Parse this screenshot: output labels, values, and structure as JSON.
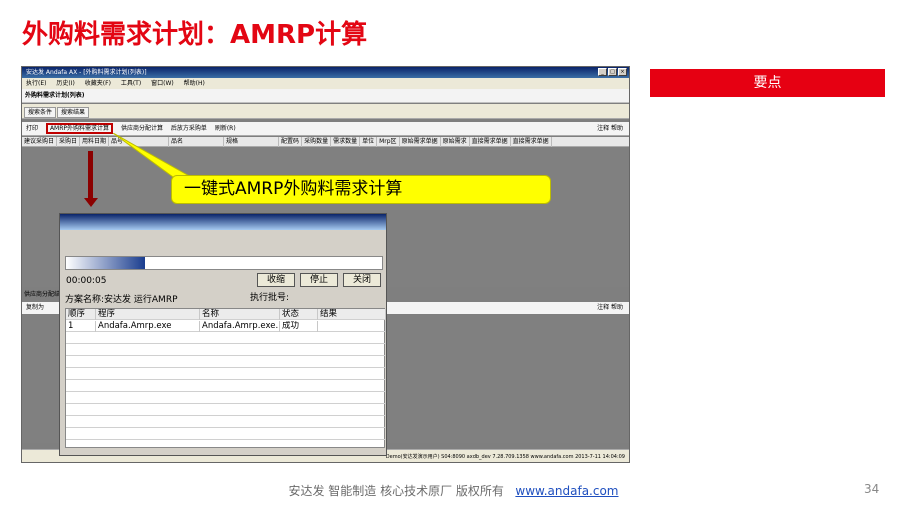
{
  "slide": {
    "title": "外购料需求计划：AMRP计算",
    "keypoint": "要点",
    "callout": "一键式AMRP外购料需求计算",
    "footer_text": "安达发   智能制造 核心技术原厂   版权所有",
    "footer_link": "www.andafa.com",
    "page_number": "34"
  },
  "app": {
    "window_title": "安达发 Andafa AX - [外购料需求计划(列表)]",
    "window_buttons": [
      "_",
      "□",
      "×"
    ],
    "menus": [
      "执行(E)",
      "历史(I)",
      "收藏夹(F)",
      "工具(T)",
      "窗口(W)",
      "帮助(H)"
    ],
    "doc_title": "外购料需求计划(列表)",
    "tabs": [
      "搜索条件",
      "搜索结果"
    ],
    "toolbar": [
      "打印",
      "AMRP外购料需求计算",
      "供应商分配计算",
      "后放方采购单",
      "刷新(R)"
    ],
    "toolbar_right": "注释 帮助",
    "columns": [
      "建议采购日",
      "采购日",
      "用料日期",
      "品号",
      "品名",
      "规格",
      "配置码",
      "采购数量",
      "需求数量",
      "单位",
      "Mrp区",
      "原始需求单据",
      "原始需求",
      "直接需求单据",
      "直接需求单据"
    ],
    "lower_label": "供应商分配结果",
    "lower_toolbar": "复制为",
    "lower_right": "注释 帮助",
    "status_bar": "Demo(安达发演示用户)  S04:8090  axdb_dev  7.28.709.1358  www.andafa.com  2013-7-11 14:04:09"
  },
  "dialog": {
    "progress_pct": 25,
    "elapsed": "00:00:05",
    "buttons": [
      "收缩",
      "停止",
      "关闭"
    ],
    "plan_label": "方案名称:安达发 运行AMRP",
    "batch_label": "执行批号:",
    "table_headers": [
      "顺序",
      "程序",
      "名称",
      "状态",
      "结果"
    ],
    "rows": [
      [
        "1",
        "Andafa.Amrp.exe",
        "Andafa.Amrp.exe...",
        "成功",
        ""
      ]
    ]
  }
}
